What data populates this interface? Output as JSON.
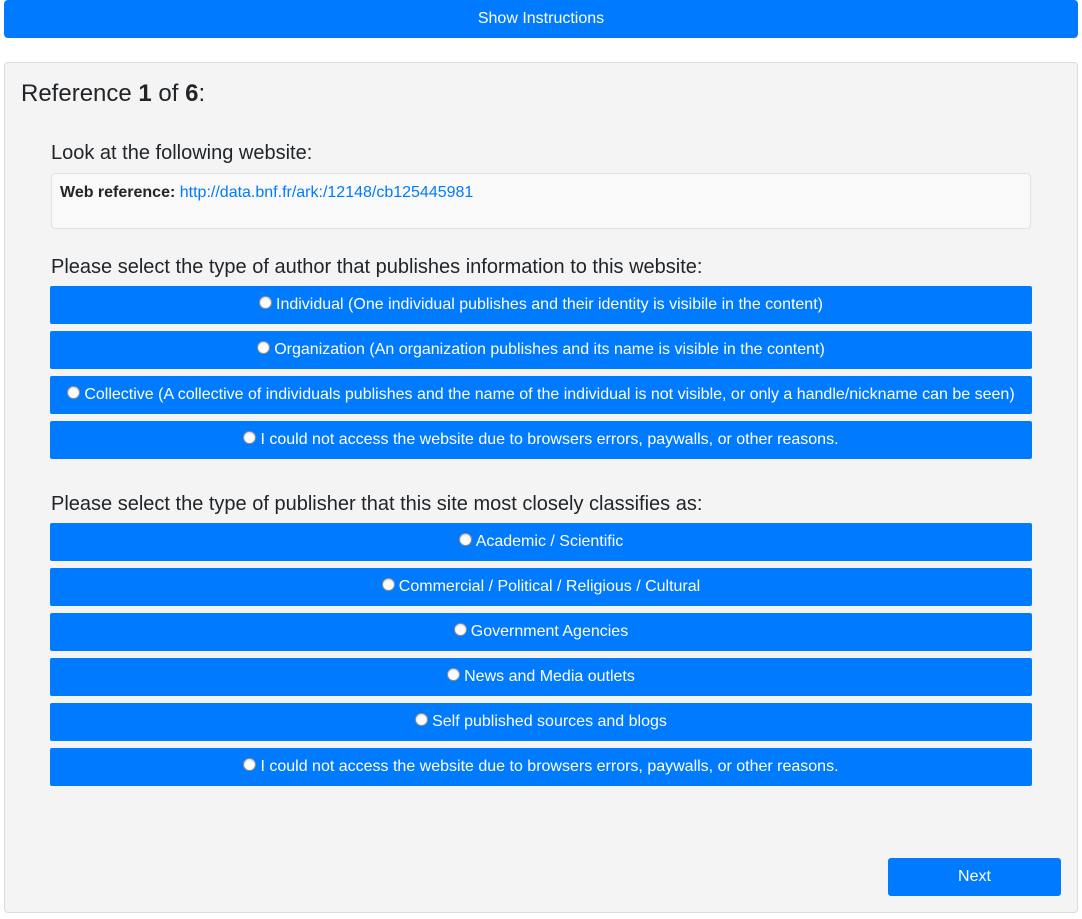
{
  "header": {
    "show_instructions_label": "Show Instructions"
  },
  "reference": {
    "prefix": "Reference ",
    "current": "1",
    "of": " of ",
    "total": "6",
    "suffix": ":"
  },
  "website_prompt": "Look at the following website:",
  "web_reference": {
    "label": "Web reference:",
    "url": "http://data.bnf.fr/ark:/12148/cb125445981"
  },
  "author_question": {
    "title": "Please select the type of author that publishes information to this website:",
    "options": [
      "Individual (One individual publishes and their identity is visibile in the content)",
      "Organization (An organization publishes and its name is visible in the content)",
      "Collective (A collective of individuals publishes and the name of the individual is not visible, or only a handle/nickname can be seen)",
      "I could not access the website due to browsers errors, paywalls, or other reasons."
    ]
  },
  "publisher_question": {
    "title": "Please select the type of publisher that this site most closely classifies as:",
    "options": [
      "Academic / Scientific",
      "Commercial / Political / Religious / Cultural",
      "Government Agencies",
      "News and Media outlets",
      "Self published sources and blogs",
      "I could not access the website due to browsers errors, paywalls, or other reasons."
    ]
  },
  "footer": {
    "next_label": "Next"
  },
  "colors": {
    "primary": "#007bff",
    "card_bg": "#f4f4f4"
  }
}
